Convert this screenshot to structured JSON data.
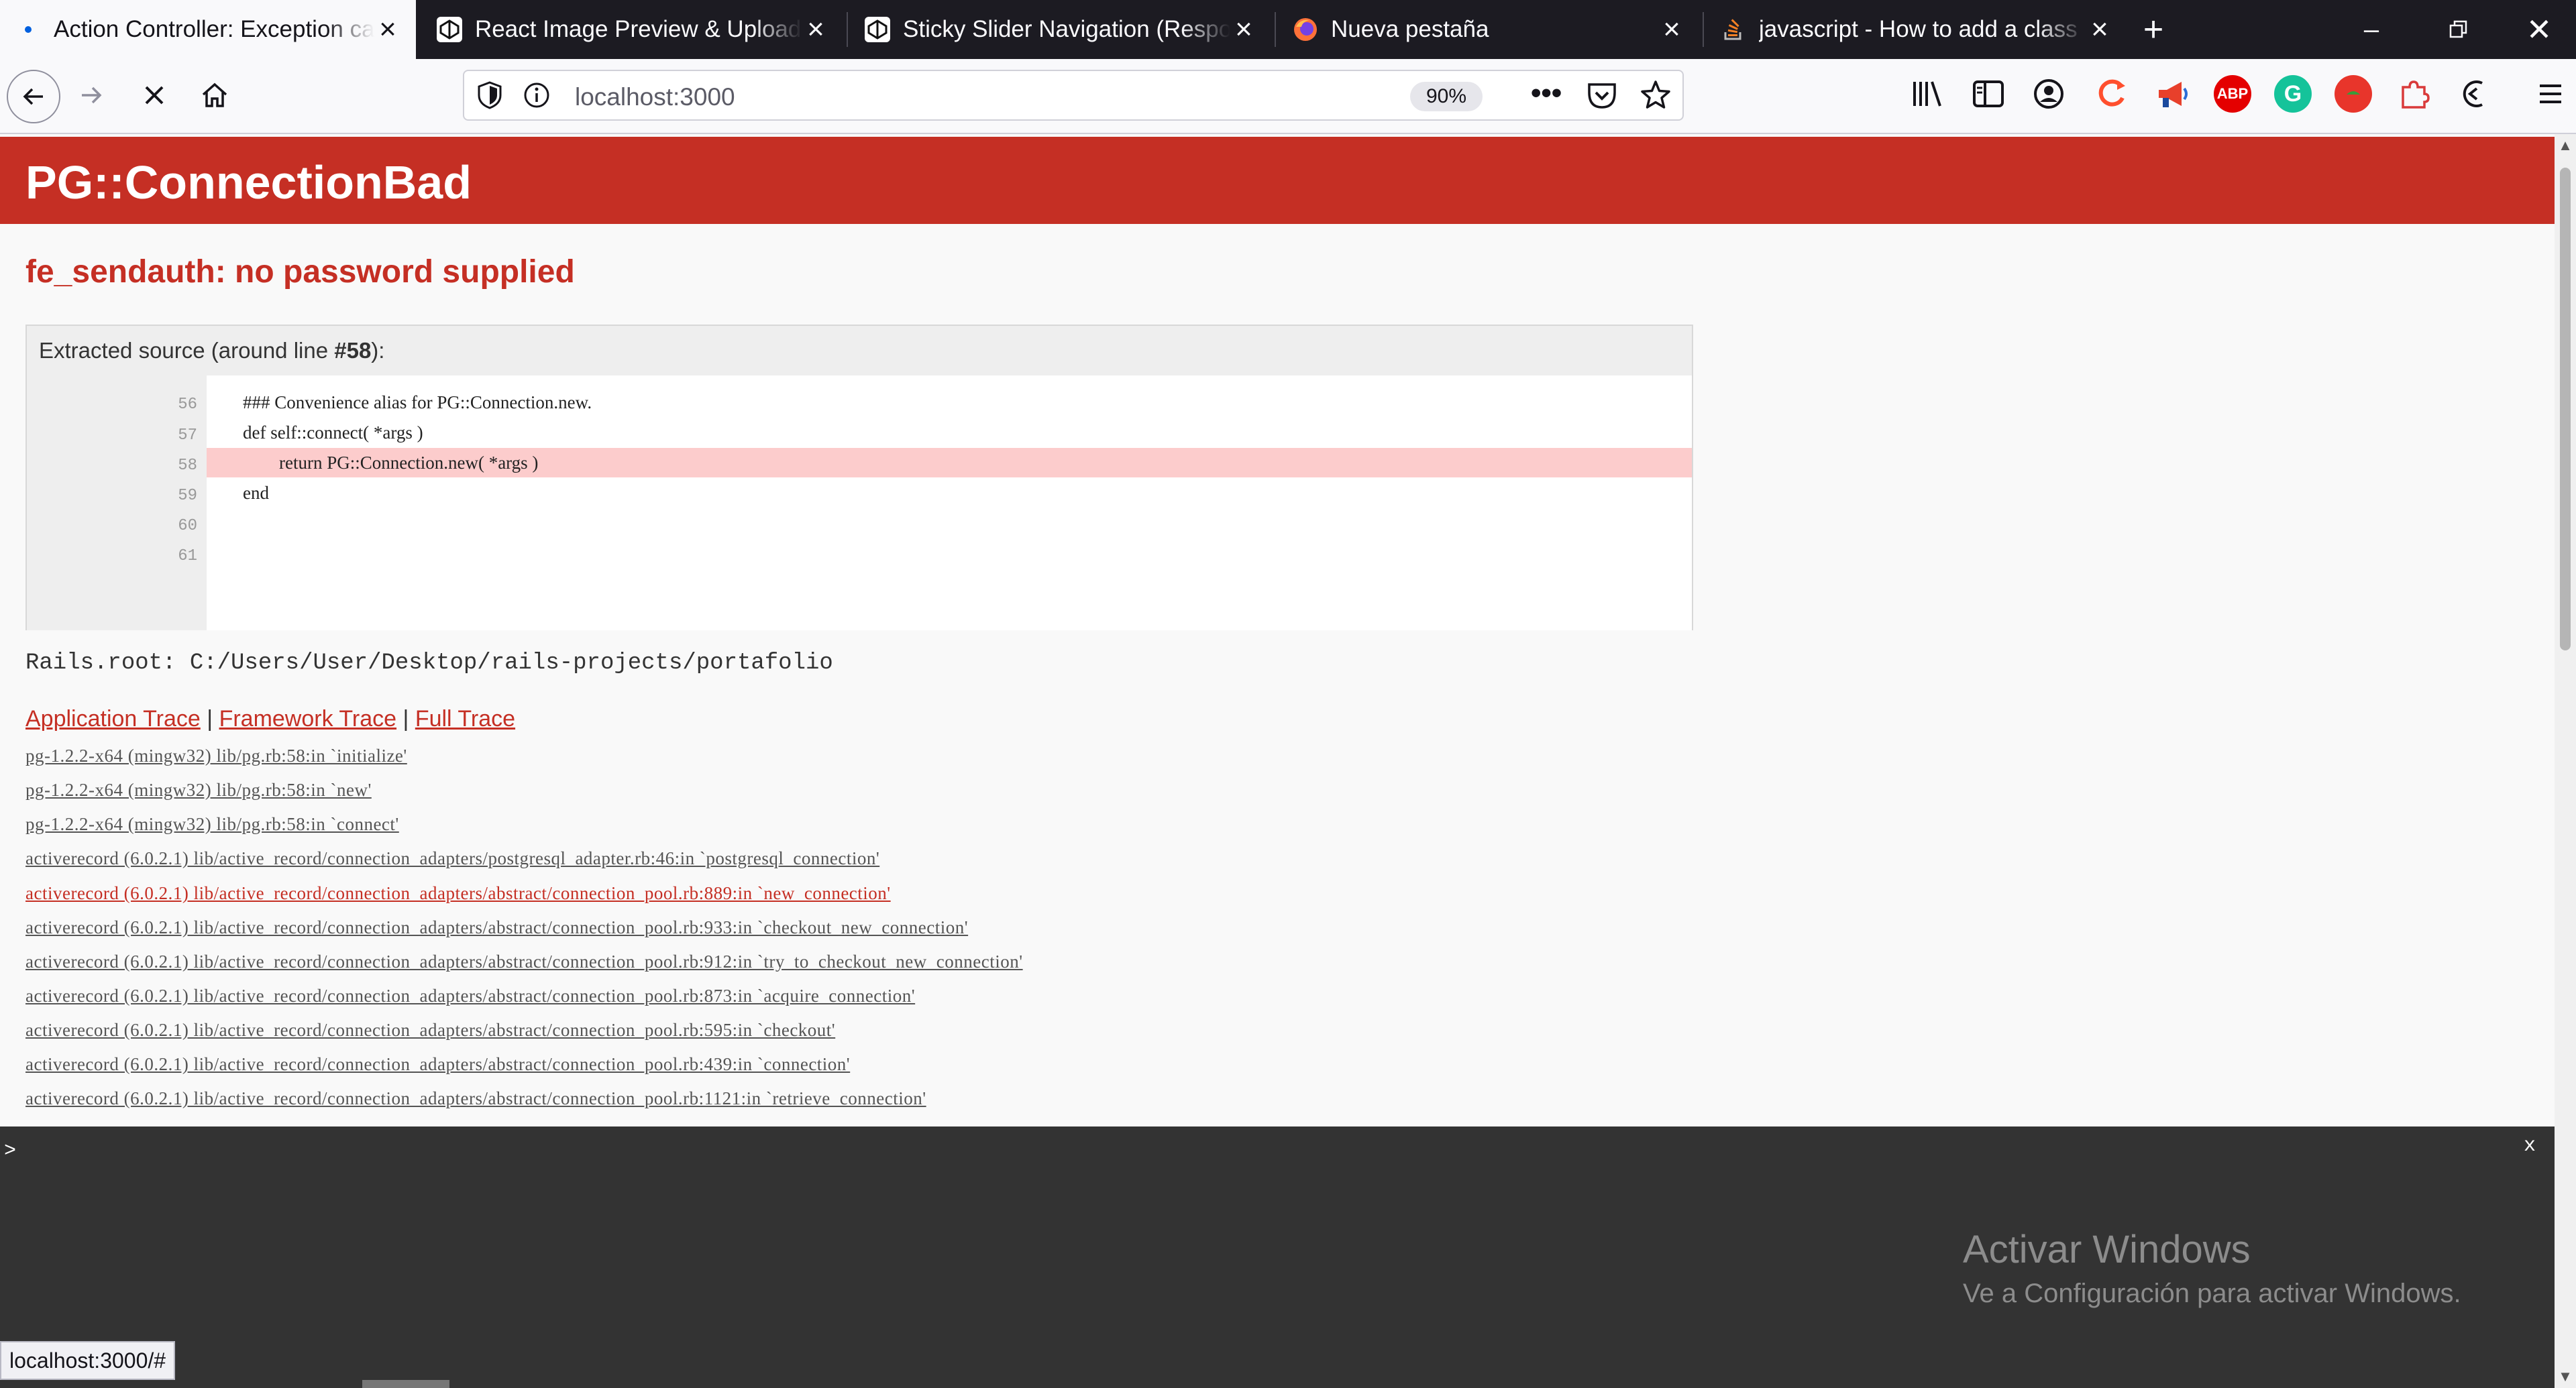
{
  "tabs": [
    {
      "title": "Action Controller: Exception ca",
      "favicon": "dot-icon",
      "active": true
    },
    {
      "title": "React Image Preview & Upload",
      "favicon": "codepen-icon"
    },
    {
      "title": "Sticky Slider Navigation (Respo",
      "favicon": "codepen-icon"
    },
    {
      "title": "Nueva pestaña",
      "favicon": "firefox-icon"
    },
    {
      "title": "javascript - How to add a class",
      "favicon": "stackoverflow-icon"
    }
  ],
  "navbar": {
    "url": "localhost:3000",
    "zoom": "90%"
  },
  "page": {
    "error_title": "PG::ConnectionBad",
    "error_message": "fe_sendauth: no password supplied",
    "source_label_prefix": "Extracted source (around line ",
    "source_label_line": "#58",
    "source_label_suffix": "):",
    "source_lines": [
      {
        "num": "56",
        "code": "        ### Convenience alias for PG::Connection.new.",
        "highlight": false
      },
      {
        "num": "57",
        "code": "        def self::connect( *args )",
        "highlight": false
      },
      {
        "num": "58",
        "code": "                return PG::Connection.new( *args )",
        "highlight": true
      },
      {
        "num": "59",
        "code": "        end",
        "highlight": false
      },
      {
        "num": "60",
        "code": "",
        "highlight": false
      },
      {
        "num": "61",
        "code": "",
        "highlight": false
      }
    ],
    "rails_root": "Rails.root: C:/Users/User/Desktop/rails-projects/portafolio",
    "trace_links": {
      "application": "Application Trace",
      "framework": "Framework Trace",
      "full": "Full Trace",
      "separator": "|"
    },
    "trace_lines": [
      {
        "text": "pg-1.2.2-x64 (mingw32) lib/pg.rb:58:in `initialize'",
        "highlight": false
      },
      {
        "text": "pg-1.2.2-x64 (mingw32) lib/pg.rb:58:in `new'",
        "highlight": false
      },
      {
        "text": "pg-1.2.2-x64 (mingw32) lib/pg.rb:58:in `connect'",
        "highlight": false
      },
      {
        "text": "activerecord (6.0.2.1) lib/active_record/connection_adapters/postgresql_adapter.rb:46:in `postgresql_connection'",
        "highlight": false
      },
      {
        "text": "activerecord (6.0.2.1) lib/active_record/connection_adapters/abstract/connection_pool.rb:889:in `new_connection'",
        "highlight": true
      },
      {
        "text": "activerecord (6.0.2.1) lib/active_record/connection_adapters/abstract/connection_pool.rb:933:in `checkout_new_connection'",
        "highlight": false
      },
      {
        "text": "activerecord (6.0.2.1) lib/active_record/connection_adapters/abstract/connection_pool.rb:912:in `try_to_checkout_new_connection'",
        "highlight": false
      },
      {
        "text": "activerecord (6.0.2.1) lib/active_record/connection_adapters/abstract/connection_pool.rb:873:in `acquire_connection'",
        "highlight": false
      },
      {
        "text": "activerecord (6.0.2.1) lib/active_record/connection_adapters/abstract/connection_pool.rb:595:in `checkout'",
        "highlight": false
      },
      {
        "text": "activerecord (6.0.2.1) lib/active_record/connection_adapters/abstract/connection_pool.rb:439:in `connection'",
        "highlight": false
      },
      {
        "text": "activerecord (6.0.2.1) lib/active_record/connection_adapters/abstract/connection_pool.rb:1121:in `retrieve_connection'",
        "highlight": false
      }
    ]
  },
  "console": {
    "prompt": ">",
    "close": "x",
    "activation_title": "Activar Windows",
    "activation_subtitle": "Ve a Configuración para activar Windows."
  },
  "status_bar": "localhost:3000/#",
  "colors": {
    "error_red": "#c52f24",
    "tabbar_bg": "#1c1b22",
    "console_bg": "#333333",
    "highlight_line": "#fccccc"
  }
}
